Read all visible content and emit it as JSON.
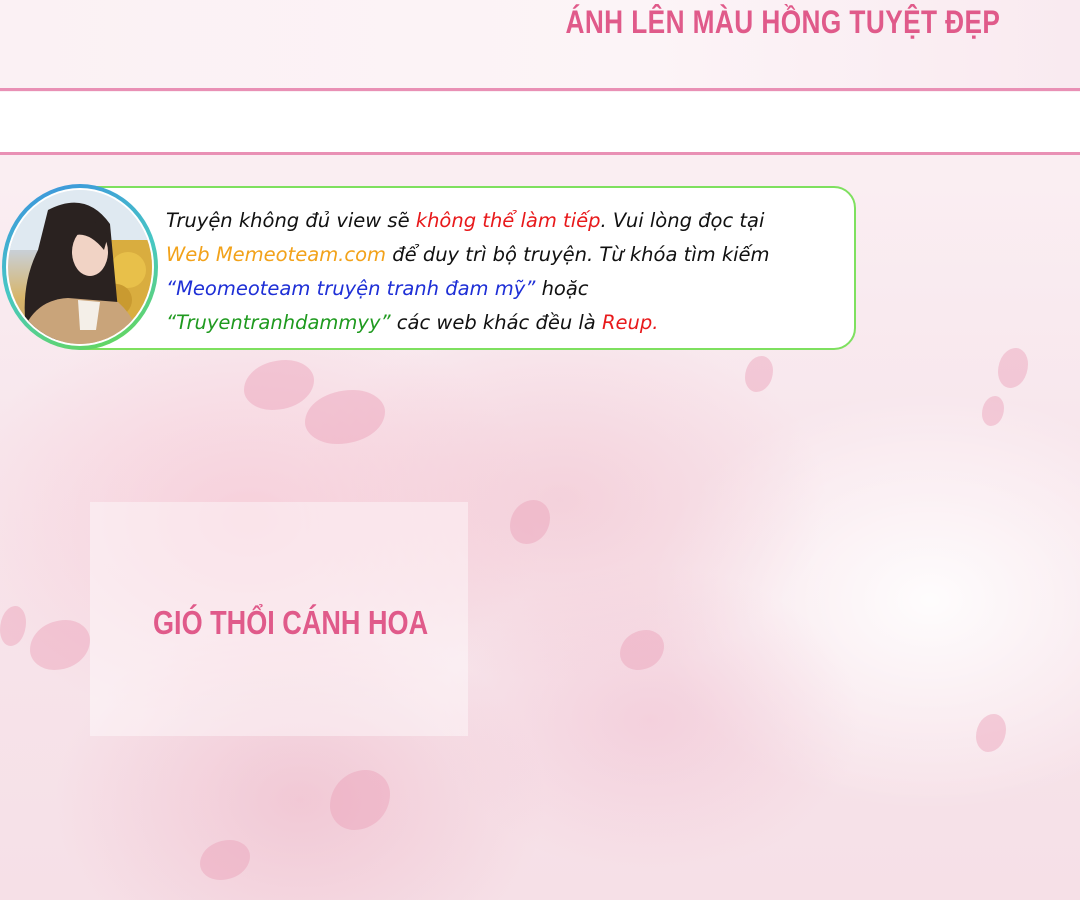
{
  "header": {
    "title": "ÁNH LÊN MÀU HỒNG TUYỆT ĐẸP"
  },
  "notice": {
    "line1_a": "Truyện không đủ view sẽ ",
    "line1_b": "không thể làm tiếp",
    "line1_c": ". Vui lòng đọc tại",
    "line2_a": "Web Memeoteam.com",
    "line2_b": " để duy trì bộ truyện. Từ khóa tìm kiếm",
    "line3_a": "“Meomeoteam truyện tranh đam mỹ”",
    "line3_b": " hoặc",
    "line4_a": "“Truyentranhdammyy”",
    "line4_b": " các web khác đều là ",
    "line4_c": "Reup",
    "line4_d": "."
  },
  "caption": {
    "title": "GIÓ THỔI CÁNH HOA"
  },
  "colors": {
    "accent_pink": "#e05a8a",
    "rule_pink": "#e990b5",
    "notice_border": "#7ee05f",
    "red": "#e8191b",
    "orange": "#f2a21a",
    "blue": "#1e2fd6",
    "green": "#1f9a1f"
  }
}
